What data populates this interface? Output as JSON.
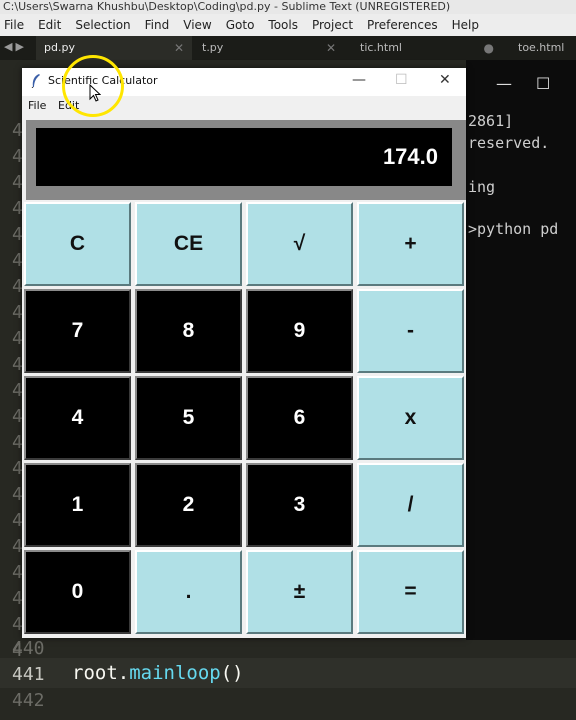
{
  "sublime": {
    "title": "C:\\Users\\Swarna Khushbu\\Desktop\\Coding\\pd.py - Sublime Text (UNREGISTERED)",
    "menu": [
      "File",
      "Edit",
      "Selection",
      "Find",
      "View",
      "Goto",
      "Tools",
      "Project",
      "Preferences",
      "Help"
    ],
    "tabs": [
      {
        "label": "pd.py",
        "active": true
      },
      {
        "label": "t.py",
        "active": false
      },
      {
        "label": "tic.html",
        "active": false
      },
      {
        "label": "toe.html",
        "active": false
      }
    ],
    "gutter": [
      "4",
      "4",
      "4",
      "4",
      "4",
      "4",
      "4",
      "4",
      "4",
      "4",
      "4",
      "4",
      "4",
      "4",
      "4",
      "4",
      "4",
      "4",
      "4",
      "4",
      "4"
    ],
    "line440": "440",
    "line441": "441",
    "line442": "442",
    "code441": {
      "id": "root",
      "dot": ".",
      "fn": "mainloop",
      "par": "()"
    },
    "console_lines": [
      "2861]",
      "reserved.",
      "ing",
      ">python pd"
    ],
    "console_window": {
      "minimize": "—",
      "maximize": "☐"
    }
  },
  "calculator": {
    "title": "Scientific Calculator",
    "menu": [
      "File",
      "Edit"
    ],
    "window_controls": {
      "minimize": "—",
      "maximize": "☐",
      "close": "✕"
    },
    "display": "174.0",
    "keys": [
      [
        "C",
        "CE",
        "√",
        "+"
      ],
      [
        "7",
        "8",
        "9",
        "-"
      ],
      [
        "4",
        "5",
        "6",
        "x"
      ],
      [
        "1",
        "2",
        "3",
        "/"
      ],
      [
        "0",
        ".",
        "±",
        "="
      ]
    ],
    "key_styles": [
      [
        "light",
        "light",
        "light",
        "light"
      ],
      [
        "dark",
        "dark",
        "dark",
        "light"
      ],
      [
        "dark",
        "dark",
        "dark",
        "light"
      ],
      [
        "dark",
        "dark",
        "dark",
        "light"
      ],
      [
        "dark",
        "light",
        "light",
        "light"
      ]
    ]
  },
  "colors": {
    "key_light": "#b0e0e6",
    "key_dark": "#000000",
    "display_bg": "#000000",
    "editor_bg": "#272822"
  }
}
